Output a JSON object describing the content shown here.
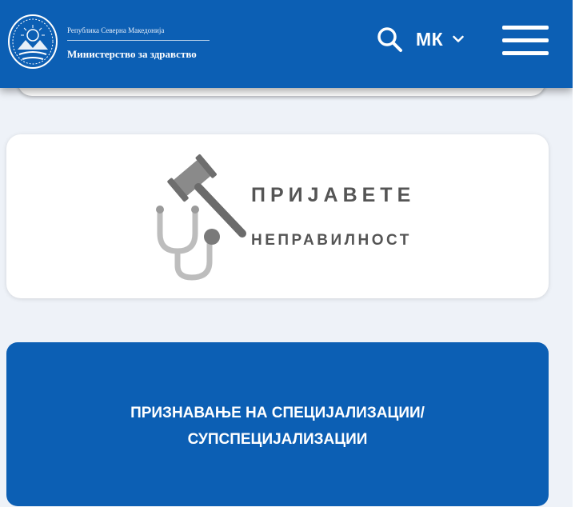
{
  "header": {
    "brand_top": "Република Северна Македонија",
    "brand_main": "Министерство за здравство",
    "emblem_icon": "coat-of-arms-icon",
    "search_icon": "search-icon",
    "language": "МК",
    "language_icon": "chevron-down-icon",
    "menu_icon": "hamburger-menu-icon",
    "background_color": "#0c5fb4"
  },
  "report_card": {
    "title": "ПРИЈАВЕТЕ",
    "subtitle": "НЕПРАВИЛНОСТ",
    "icons": [
      "gavel-icon",
      "stethoscope-icon"
    ]
  },
  "spec_card": {
    "line1": "ПРИЗНАВАЊЕ НА СПЕЦИЈАЛИЗАЦИИ/",
    "line2": "СУПСПЕЦИЈАЛИЗАЦИИ",
    "background_color": "#0c5fb4"
  }
}
